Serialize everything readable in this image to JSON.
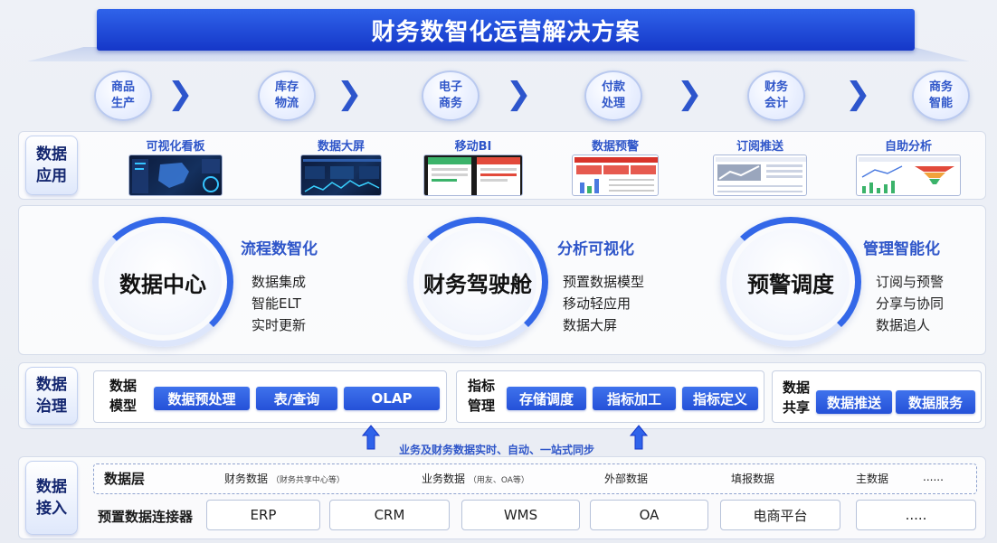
{
  "title": "财务数智化运营解决方案",
  "process": [
    "商品生产",
    "库存物流",
    "电子商务",
    "付款处理",
    "财务会计",
    "商务智能"
  ],
  "chevron_glyph": "❯",
  "sections": {
    "application": "数据应用",
    "governance": "数据治理",
    "access": "数据接入"
  },
  "apps": [
    "可视化看板",
    "数据大屏",
    "移动BI",
    "数据预警",
    "订阅推送",
    "自助分析"
  ],
  "modules": [
    {
      "name": "数据中心",
      "heading": "流程数智化",
      "items": [
        "数据集成",
        "智能ELT",
        "实时更新"
      ]
    },
    {
      "name": "财务驾驶舱",
      "heading": "分析可视化",
      "items": [
        "预置数据模型",
        "移动轻应用",
        "数据大屏"
      ]
    },
    {
      "name": "预警调度",
      "heading": "管理智能化",
      "items": [
        "订阅与预警",
        "分享与协同",
        "数据追人"
      ]
    }
  ],
  "governance": {
    "model": {
      "label": "数据模型",
      "chips": [
        "数据预处理",
        "表/查询",
        "OLAP"
      ]
    },
    "indicator": {
      "label": "指标管理",
      "chips": [
        "存储调度",
        "指标加工",
        "指标定义"
      ]
    },
    "sharing": {
      "label": "数据共享",
      "chips": [
        "数据推送",
        "数据服务"
      ]
    }
  },
  "sync_text": "业务及财务数据实时、自动、一站式同步",
  "data_layer": {
    "label": "数据层",
    "items": [
      {
        "name": "财务数据",
        "sub": "（财务共享中心等）"
      },
      {
        "name": "业务数据",
        "sub": "（用友、OA等）"
      },
      {
        "name": "外部数据",
        "sub": ""
      },
      {
        "name": "填报数据",
        "sub": ""
      },
      {
        "name": "主数据",
        "sub": ""
      },
      {
        "name": "......",
        "sub": ""
      }
    ]
  },
  "connectors": {
    "label": "预置数据连接器",
    "items": [
      "ERP",
      "CRM",
      "WMS",
      "OA",
      "电商平台",
      "....."
    ]
  },
  "colors": {
    "primary": "#2551d8",
    "accent_text": "#2f56c9",
    "ring": "#3468e8"
  }
}
